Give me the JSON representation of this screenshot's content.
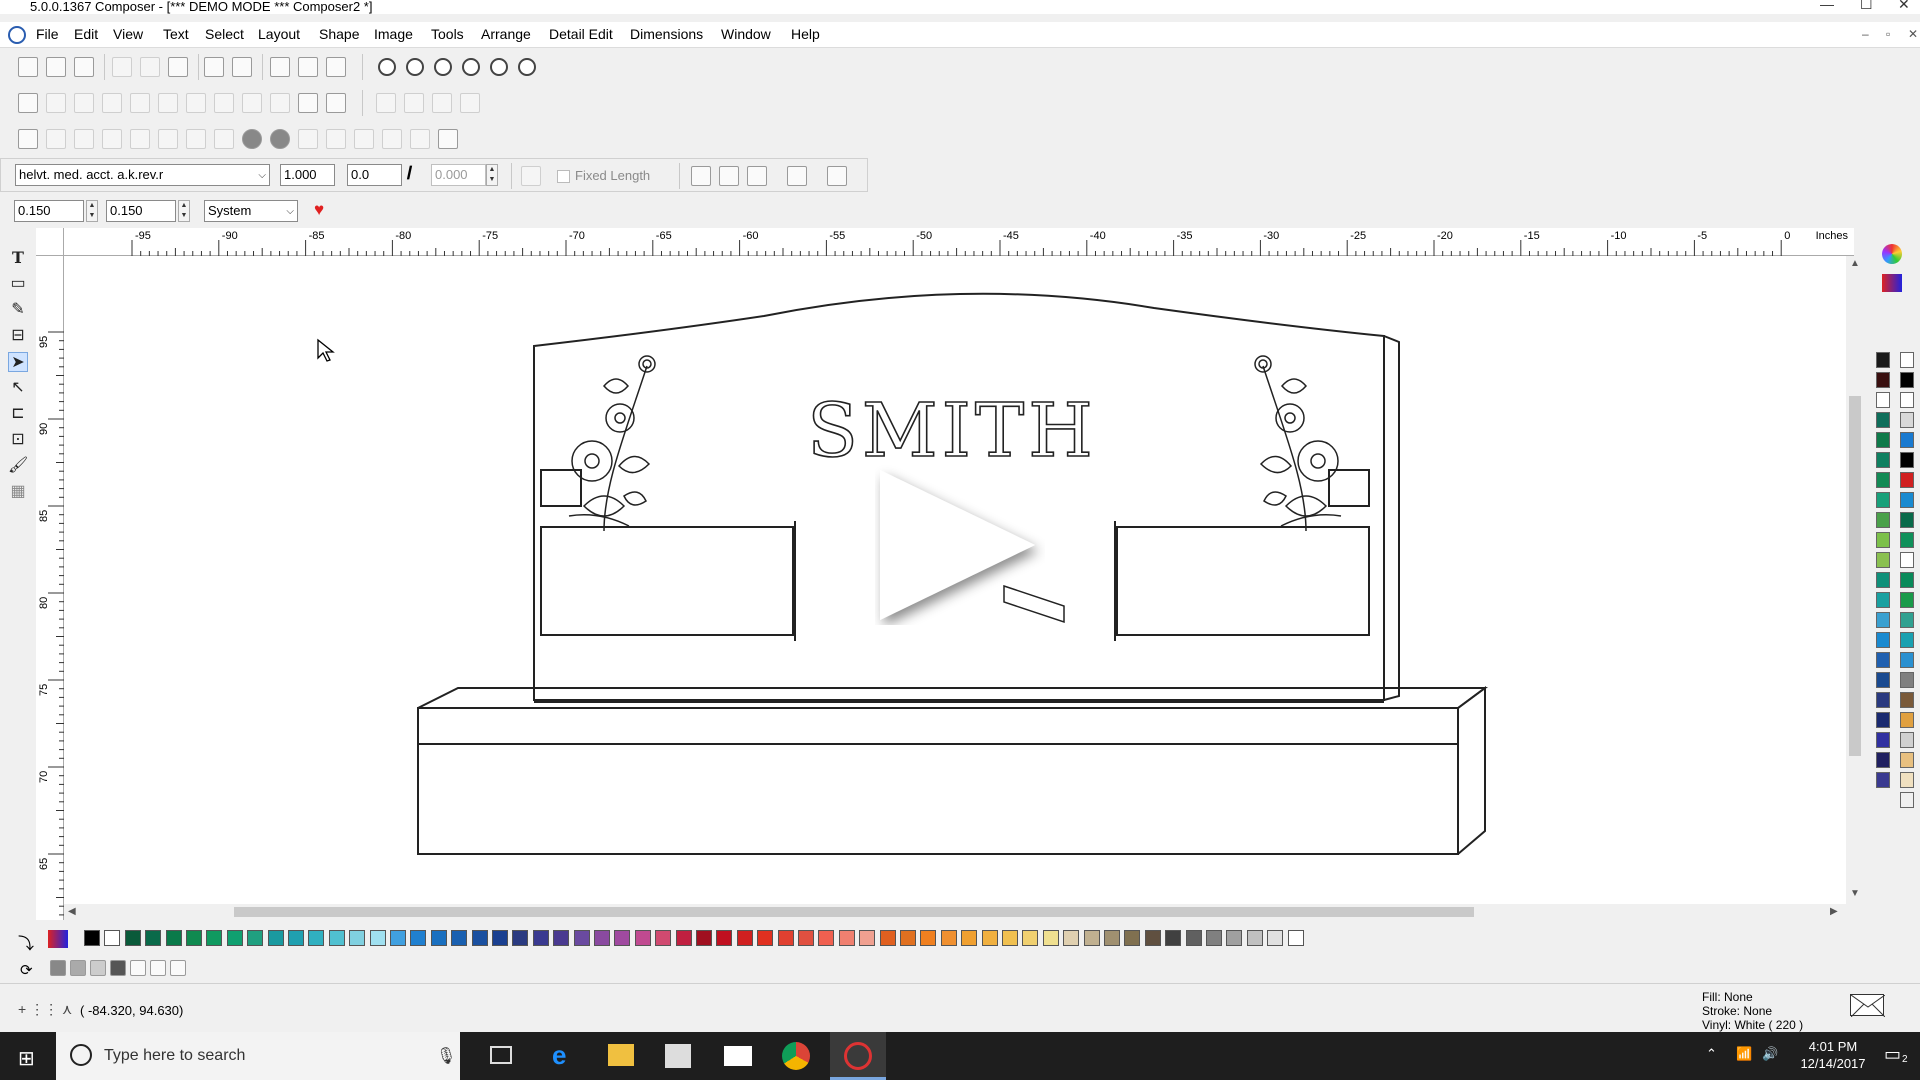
{
  "window": {
    "title": "5.0.0.1367 Composer - [*** DEMO MODE *** Composer2 *]",
    "min_glyph": "—",
    "max_glyph": "☐",
    "close_glyph": "✕"
  },
  "menu": {
    "items": [
      "File",
      "Edit",
      "View",
      "Text",
      "Select",
      "Layout",
      "Shape",
      "Image",
      "Tools",
      "Arrange",
      "Detail Edit",
      "Dimensions",
      "Window",
      "Help"
    ],
    "mdi_controls": [
      "–",
      "▫",
      "✕"
    ]
  },
  "text_toolbar": {
    "font": "helvt. med. acct. a.k.rev.r",
    "scale": "1.000",
    "angle": "0.0",
    "italic_glyph": "𝐼",
    "length_value": "0.000",
    "fixed_length_label": "Fixed Length",
    "fixed_length_checked": false
  },
  "size_toolbar": {
    "width": "0.150",
    "height": "0.150",
    "unit_system": "System"
  },
  "ruler": {
    "unit_label": "Inches",
    "h_ticks": [
      "-95",
      "-90",
      "-85",
      "-80",
      "-75",
      "-70",
      "-65",
      "-60",
      "-55",
      "-50",
      "-45",
      "-40",
      "-35",
      "-30",
      "-25",
      "-20",
      "-15",
      "-10",
      "-5",
      "0"
    ],
    "v_ticks": [
      "95",
      "90",
      "85",
      "80",
      "75",
      "70",
      "65"
    ]
  },
  "canvas": {
    "design_text": "SMITH",
    "play_overlay": true
  },
  "status": {
    "coordinates": "( -84.320, 94.630)",
    "fill": "Fill: None",
    "stroke": "Stroke: None",
    "vinyl": "Vinyl: White ( 220 )"
  },
  "taskbar": {
    "search_placeholder": "Type here to search",
    "time": "4:01 PM",
    "date": "12/14/2017",
    "notification_count": "2"
  },
  "palette": {
    "right": [
      "#1a1a1a",
      "#3a1010",
      "#ffffff",
      "#0e6e5a",
      "#0f7a4a",
      "#0f8060",
      "#138a55",
      "#19a07a",
      "#4aa04a",
      "#7cc04a",
      "#8ac050",
      "#10907a",
      "#1aa0a0",
      "#3aa0d0",
      "#1a8ad0",
      "#2060b0",
      "#1a4a90",
      "#2a3a80",
      "#1a2a70",
      "#3030a0",
      "#202060",
      "#3a3a90"
    ],
    "right2": [
      "#ffffff",
      "#000000",
      "#ffffff",
      "#d8d8d8",
      "#1a7ad0",
      "#000000",
      "#d02020",
      "#1a8ad0",
      "#0a6a4a",
      "#10905a",
      "#ffffff",
      "#0a8a5a",
      "#1a9a4a",
      "#30a090",
      "#1aa0b0",
      "#2a90d0",
      "#808080",
      "#7a5a3a",
      "#e0a040",
      "#d0d0d0",
      "#e8c080",
      "#f0e0c0",
      "#f0f0f0"
    ],
    "bottom": [
      "#000000",
      "#ffffff",
      "#0a5a3a",
      "#0a6a4a",
      "#0a7a4a",
      "#108a50",
      "#109a60",
      "#10a070",
      "#20a080",
      "#1a9aa0",
      "#20a0b0",
      "#30b0c0",
      "#50c0d0",
      "#80d0e0",
      "#a0e0f0",
      "#40a0e0",
      "#2080d0",
      "#1a70c0",
      "#1a60b0",
      "#1a50a0",
      "#1a4090",
      "#2a3a80",
      "#3a3a90",
      "#4a3a90",
      "#6a4aa0",
      "#8a4aa0",
      "#a04aa0",
      "#c04a90",
      "#d04a70",
      "#c02040",
      "#a01020",
      "#c01020",
      "#d02020",
      "#e03020",
      "#e04030",
      "#e05040",
      "#f06050",
      "#f08070",
      "#f0a090",
      "#e06020",
      "#e07020",
      "#f08020",
      "#f09030",
      "#f0a030",
      "#f0b040",
      "#f0c050",
      "#f0d070",
      "#f0e090",
      "#e0d0b0",
      "#c0b090",
      "#a09070",
      "#807050",
      "#605040",
      "#404040",
      "#606060",
      "#808080",
      "#a0a0a0",
      "#c0c0c0",
      "#e0e0e0",
      "#ffffff"
    ]
  }
}
